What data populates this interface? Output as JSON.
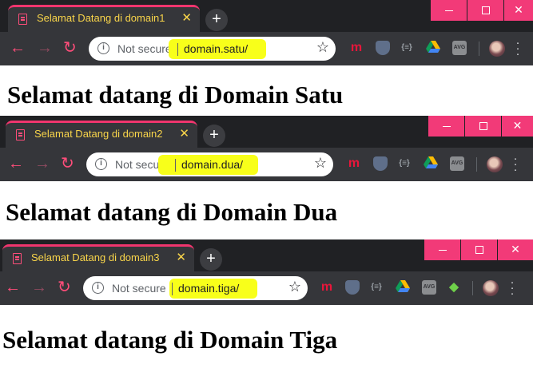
{
  "windows": [
    {
      "tab_title": "Selamat Datang di domain1",
      "tab_close": "✕",
      "new_tab": "+",
      "security_label": "Not secure",
      "url": "domain.satu/",
      "page_heading": "Selamat datang di Domain Satu"
    },
    {
      "tab_title": "Selamat Datang di domain2",
      "tab_close": "✕",
      "new_tab": "+",
      "security_label": "Not secure",
      "url": "domain.dua/",
      "page_heading": "Selamat datang di Domain Dua"
    },
    {
      "tab_title": "Selamat Datang di domain3",
      "tab_close": "✕",
      "new_tab": "+",
      "security_label": "Not secure",
      "url": "domain.tiga/",
      "page_heading": "Selamat datang di Domain Tiga"
    }
  ],
  "window_controls": {
    "close": "✕"
  },
  "extensions": {
    "m": "m",
    "json": "{≡}",
    "avg": "AVG"
  },
  "colors": {
    "accent": "#f23a78",
    "tab_title": "#f9d54a",
    "url_highlight": "#f8ff1a",
    "frame": "#202124",
    "toolbar": "#35363a"
  }
}
